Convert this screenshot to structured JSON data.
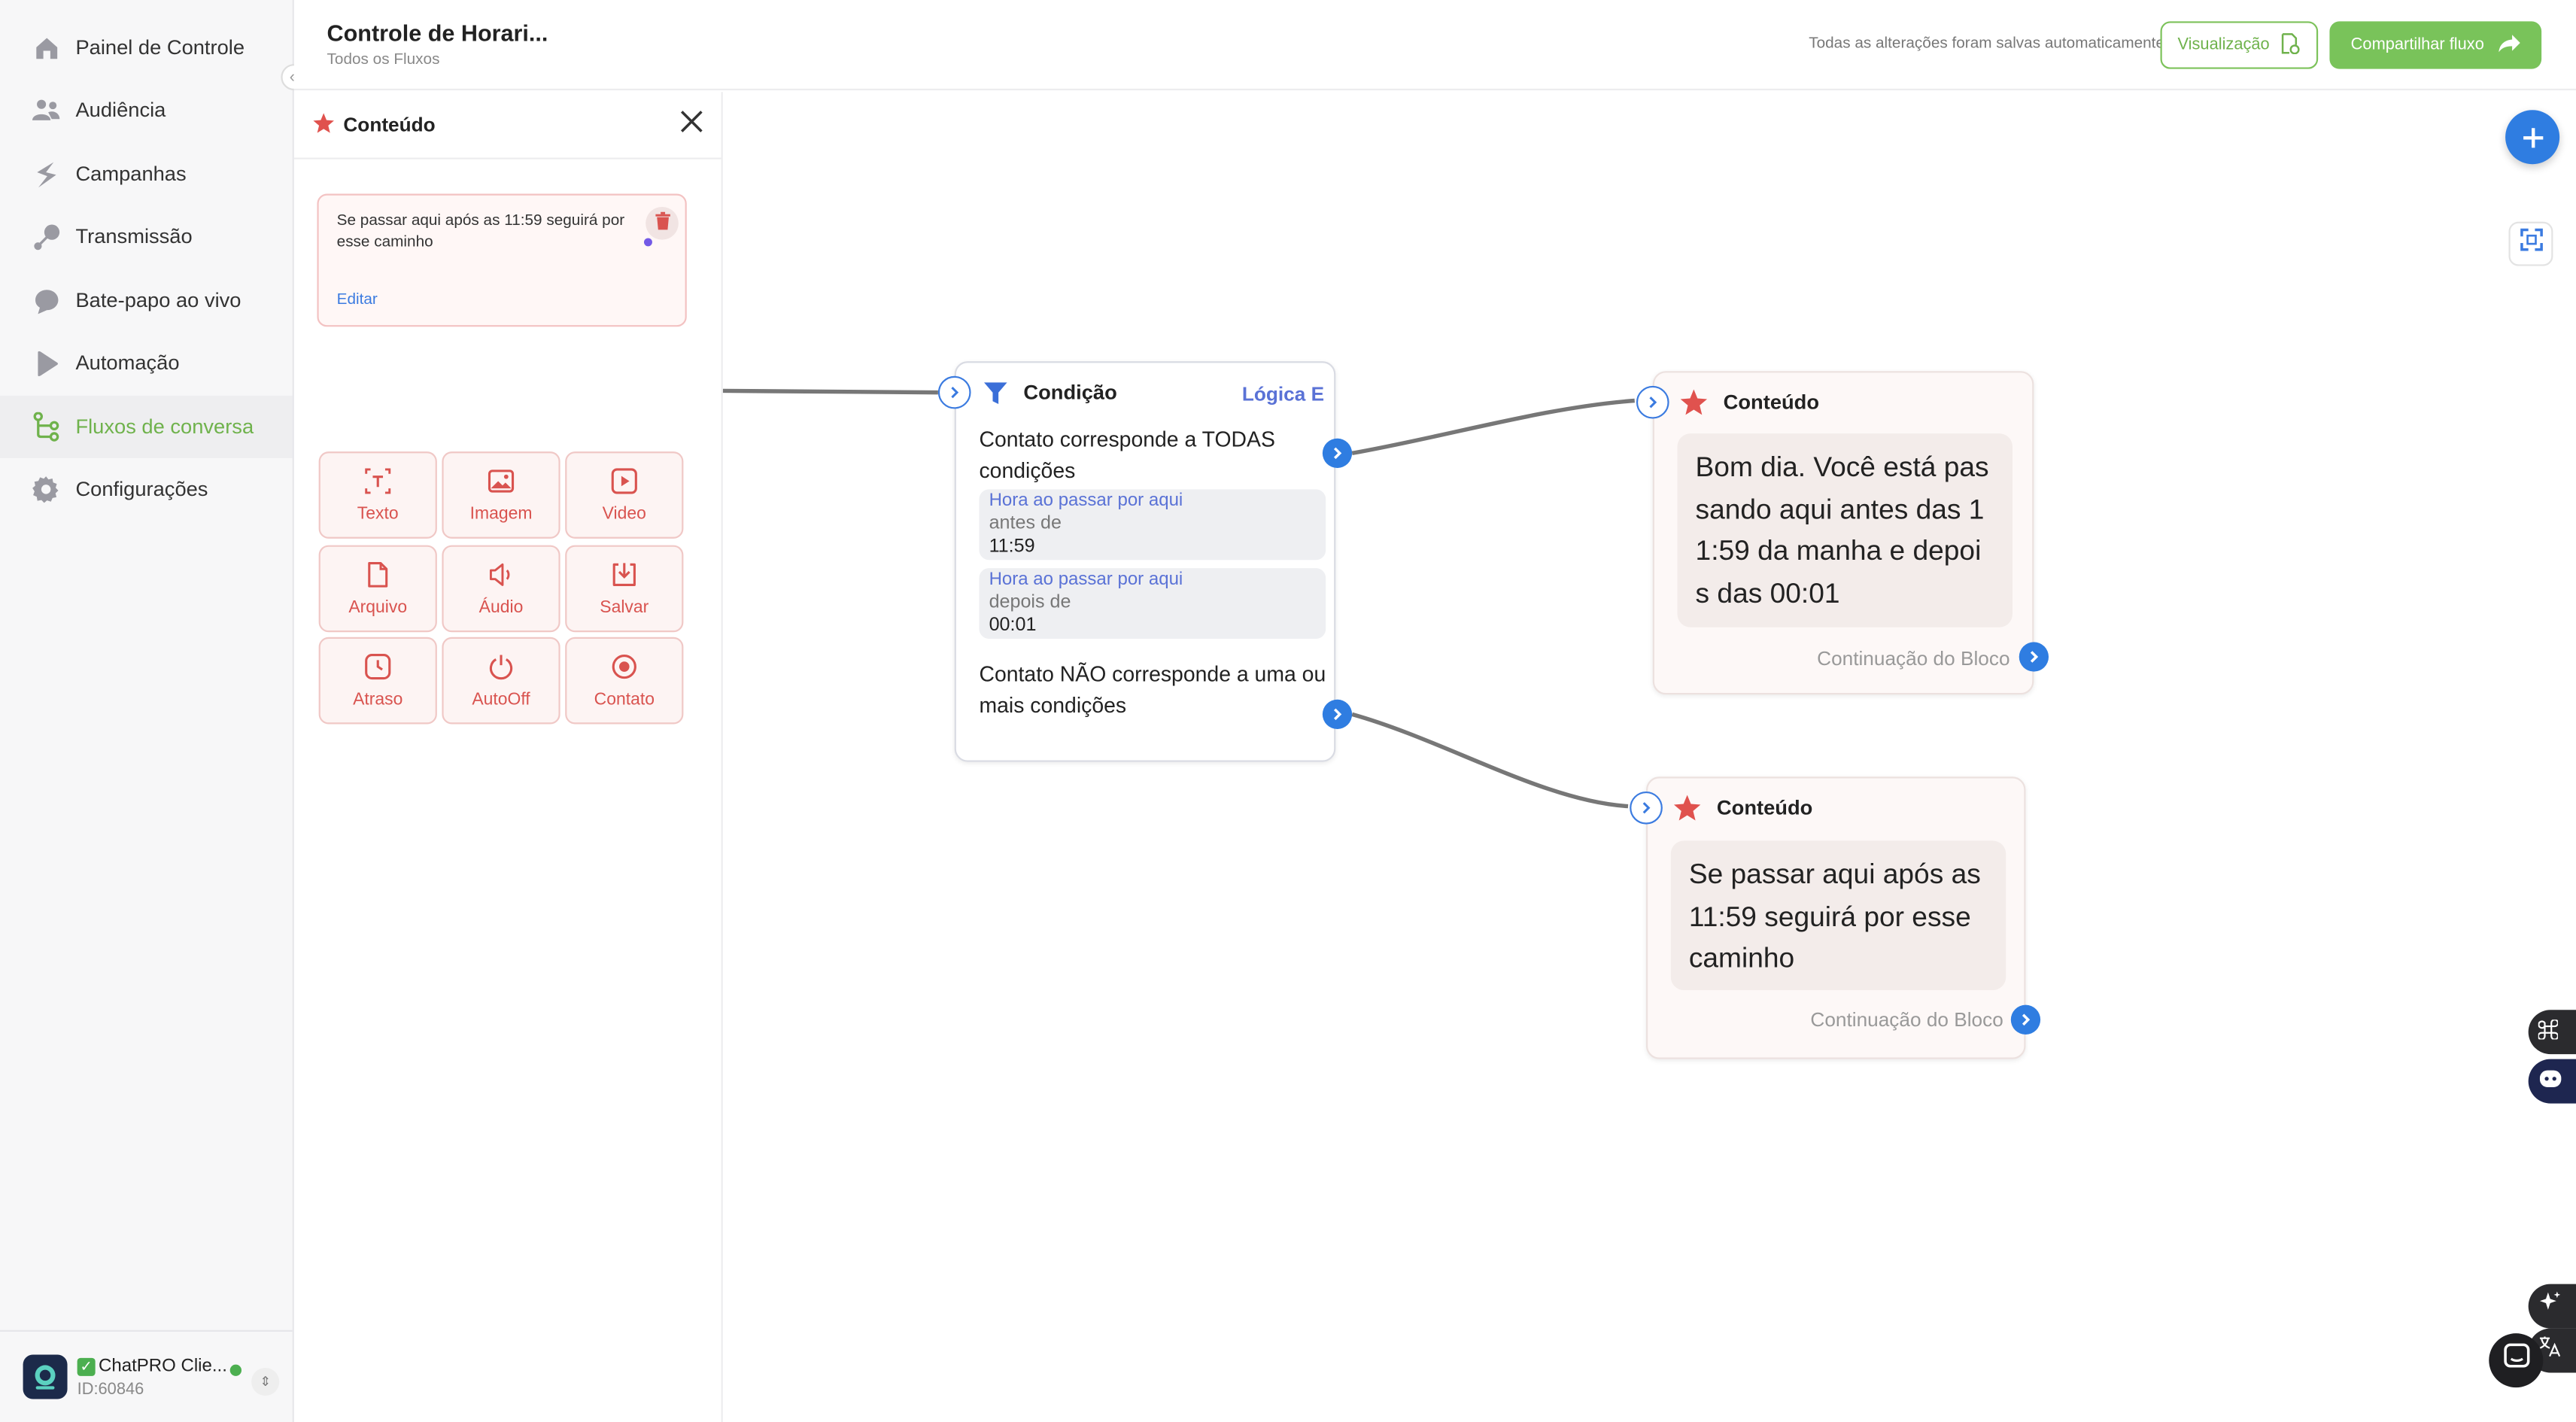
{
  "sidebar": {
    "items": [
      {
        "label": "Painel de Controle",
        "icon": "home-icon"
      },
      {
        "label": "Audiência",
        "icon": "users-icon"
      },
      {
        "label": "Campanhas",
        "icon": "campaign-icon"
      },
      {
        "label": "Transmissão",
        "icon": "broadcast-icon"
      },
      {
        "label": "Bate-papo ao vivo",
        "icon": "chat-bubble-icon"
      },
      {
        "label": "Automação",
        "icon": "automation-icon"
      },
      {
        "label": "Fluxos de conversa",
        "icon": "flow-icon",
        "active": true
      },
      {
        "label": "Configurações",
        "icon": "gear-icon"
      }
    ],
    "account": {
      "name": "ChatPRO Clie...",
      "id": "ID:60846"
    }
  },
  "header": {
    "title": "Controle de Horari...",
    "breadcrumb": "Todos os Fluxos",
    "saved_status": "Todas as alterações foram salvas automaticamente",
    "preview_label": "Visualização",
    "share_label": "Compartilhar fluxo"
  },
  "panel": {
    "title": "Conteúdo",
    "message_text": "Se passar aqui após as 11:59 seguirá por esse caminho",
    "edit_label": "Editar",
    "tools": [
      {
        "label": "Texto",
        "icon": "text-icon"
      },
      {
        "label": "Imagem",
        "icon": "image-icon"
      },
      {
        "label": "Video",
        "icon": "video-icon"
      },
      {
        "label": "Arquivo",
        "icon": "file-icon"
      },
      {
        "label": "Áudio",
        "icon": "audio-icon"
      },
      {
        "label": "Salvar",
        "icon": "save-icon"
      },
      {
        "label": "Atraso",
        "icon": "clock-icon"
      },
      {
        "label": "AutoOff",
        "icon": "power-icon"
      },
      {
        "label": "Contato",
        "icon": "contact-icon"
      }
    ]
  },
  "canvas": {
    "condition_node": {
      "title": "Condição",
      "logic": "Lógica E",
      "match_all": "Contato corresponde a TODAS condições",
      "conditions": [
        {
          "label": "Hora ao passar por aqui",
          "operator": "antes de",
          "value": "11:59"
        },
        {
          "label": "Hora ao passar por aqui",
          "operator": "depois de",
          "value": "00:01"
        }
      ],
      "match_none": "Contato NÃO corresponde a uma ou mais condições"
    },
    "content_nodes": [
      {
        "title": "Conteúdo",
        "text": "Bom dia. Você está passando aqui antes das 11:59 da manha e depois das 00:01",
        "continuation": "Continuação do Bloco"
      },
      {
        "title": "Conteúdo",
        "text": "Se passar aqui após as 11:59 seguirá por esse caminho",
        "continuation": "Continuação do Bloco"
      }
    ]
  },
  "colors": {
    "accent_green": "#79c35a",
    "port_blue": "#2f7de1",
    "content_red": "#d9534f",
    "logic_purple": "#5a72d6"
  }
}
